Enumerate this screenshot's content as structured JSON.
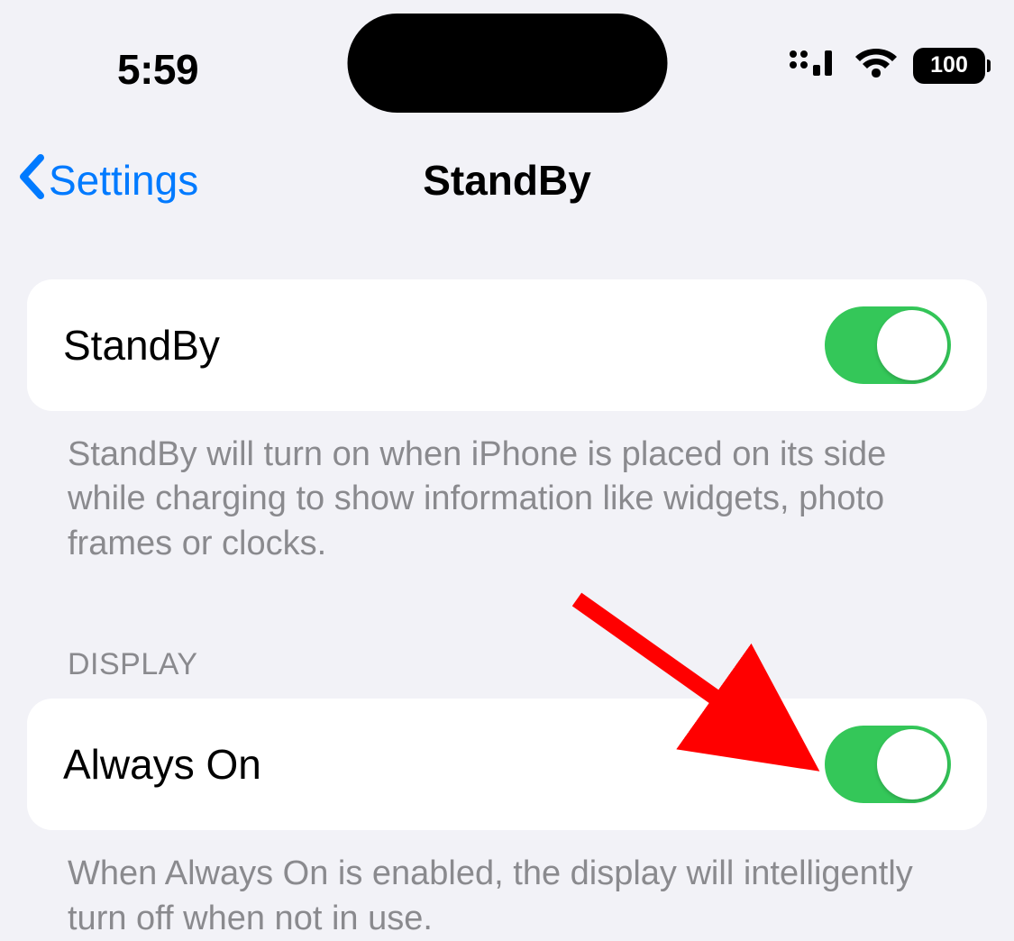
{
  "status_bar": {
    "time": "5:59",
    "battery_level": "100"
  },
  "nav": {
    "back_label": "Settings",
    "title": "StandBy"
  },
  "standby": {
    "row_label": "StandBy",
    "toggle_on": true,
    "footer": "StandBy will turn on when iPhone is placed on its side while charging to show information like widgets, photo frames or clocks."
  },
  "display_section": {
    "header": "DISPLAY",
    "always_on": {
      "label": "Always On",
      "toggle_on": true
    },
    "footer": "When Always On is enabled, the display will intelligently turn off when not in use."
  },
  "colors": {
    "accent": "#007aff",
    "toggle_on": "#34c759",
    "annotation_arrow": "#ff0000"
  }
}
